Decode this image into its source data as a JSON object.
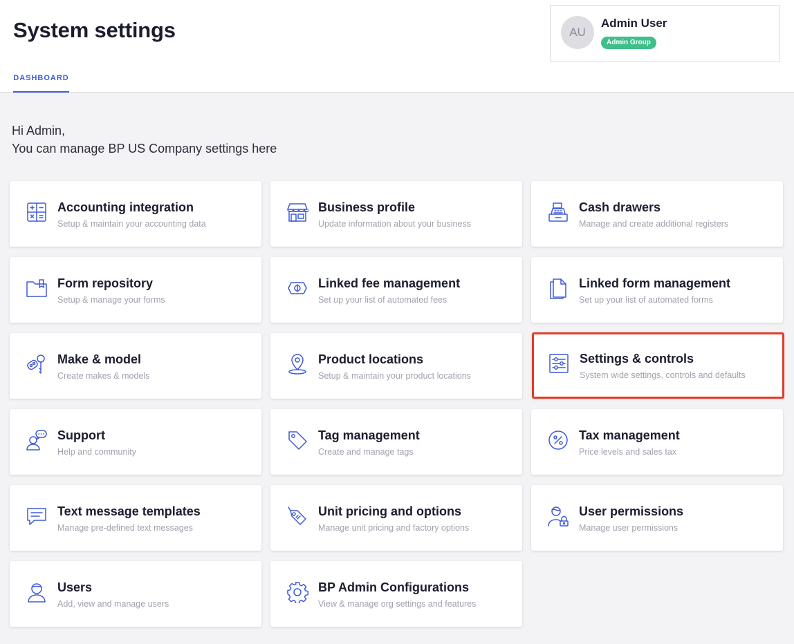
{
  "header": {
    "title": "System settings",
    "tabs": [
      {
        "label": "DASHBOARD"
      }
    ]
  },
  "user": {
    "initials": "AU",
    "name": "Admin User",
    "badge": "Admin Group"
  },
  "colors": {
    "accent": "#3f5bd8",
    "badge": "#3fbf8a",
    "highlight": "#e23d28"
  },
  "greeting": {
    "line1": "Hi Admin,",
    "line2": "You can manage BP US Company settings here"
  },
  "tiles": [
    {
      "title": "Accounting integration",
      "subtitle": "Setup & maintain your accounting data",
      "icon": "calculator-icon"
    },
    {
      "title": "Business profile",
      "subtitle": "Update information about your business",
      "icon": "storefront-icon"
    },
    {
      "title": "Cash drawers",
      "subtitle": "Manage and create additional registers",
      "icon": "cash-register-icon"
    },
    {
      "title": "Form repository",
      "subtitle": "Setup & manage your forms",
      "icon": "folder-icon"
    },
    {
      "title": "Linked fee management",
      "subtitle": "Set up your list of automated fees",
      "icon": "money-ticket-icon"
    },
    {
      "title": "Linked form management",
      "subtitle": "Set up your list of automated forms",
      "icon": "documents-icon"
    },
    {
      "title": "Make & model",
      "subtitle": "Create makes & models",
      "icon": "car-key-icon"
    },
    {
      "title": "Product locations",
      "subtitle": "Setup & maintain your product locations",
      "icon": "map-pin-icon"
    },
    {
      "title": "Settings & controls",
      "subtitle": "System wide settings, controls and defaults",
      "icon": "sliders-icon",
      "highlighted": true
    },
    {
      "title": "Support",
      "subtitle": "Help and community",
      "icon": "support-chat-icon"
    },
    {
      "title": "Tag management",
      "subtitle": "Create and manage tags",
      "icon": "tag-icon"
    },
    {
      "title": "Tax management",
      "subtitle": "Price levels and sales tax",
      "icon": "percent-icon"
    },
    {
      "title": "Text message templates",
      "subtitle": "Manage pre-defined text messages",
      "icon": "message-icon"
    },
    {
      "title": "Unit pricing and options",
      "subtitle": "Manage unit pricing and factory options",
      "icon": "price-tag-icon"
    },
    {
      "title": "User permissions",
      "subtitle": "Manage user permissions",
      "icon": "user-lock-icon"
    },
    {
      "title": "Users",
      "subtitle": "Add, view and manage users",
      "icon": "user-icon"
    },
    {
      "title": "BP Admin Configurations",
      "subtitle": "View & manage org settings and features",
      "icon": "gear-icon"
    }
  ]
}
